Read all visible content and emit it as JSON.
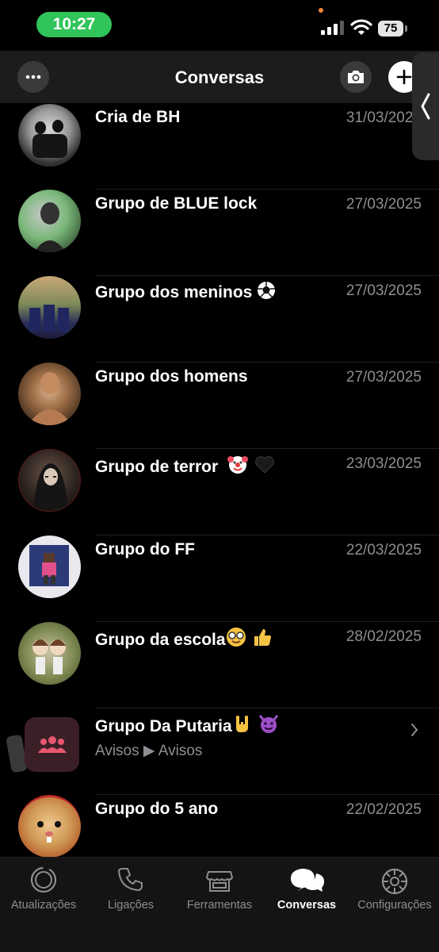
{
  "status_bar": {
    "time": "10:27",
    "battery": "75"
  },
  "nav": {
    "title": "Conversas"
  },
  "chats": [
    {
      "name": "Cria de BH",
      "date": "31/03/2025",
      "subtitle": ""
    },
    {
      "name": "Grupo de BLUE lock",
      "date": "27/03/2025",
      "subtitle": ""
    },
    {
      "name": "Grupo dos meninos",
      "date": "27/03/2025",
      "subtitle": ""
    },
    {
      "name": "Grupo dos homens",
      "date": "27/03/2025",
      "subtitle": ""
    },
    {
      "name": "Grupo de terror",
      "date": "23/03/2025",
      "subtitle": ""
    },
    {
      "name": "Grupo do FF",
      "date": "22/03/2025",
      "subtitle": ""
    },
    {
      "name": "Grupo da escola",
      "date": "28/02/2025",
      "subtitle": ""
    },
    {
      "name": "Grupo Da Putaria",
      "date": "",
      "subtitle": "Avisos ▶ Avisos"
    },
    {
      "name": "Grupo do 5 ano",
      "date": "22/02/2025",
      "subtitle": ""
    }
  ],
  "tabs": [
    {
      "label": "Atualizações",
      "icon": "status-icon",
      "active": false
    },
    {
      "label": "Ligações",
      "icon": "phone-icon",
      "active": false
    },
    {
      "label": "Ferramentas",
      "icon": "store-icon",
      "active": false
    },
    {
      "label": "Conversas",
      "icon": "chats-icon",
      "active": true
    },
    {
      "label": "Configurações",
      "icon": "gear-icon",
      "active": false
    }
  ],
  "colors": {
    "accent_green": "#30c45a",
    "background": "#000000",
    "muted_text": "#8e8e93",
    "community": "#e8566f"
  }
}
